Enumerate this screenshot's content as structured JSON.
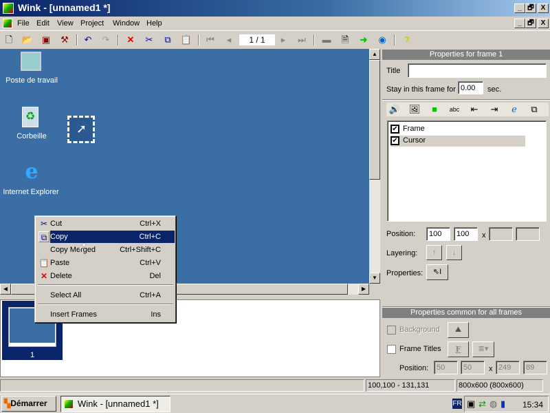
{
  "window": {
    "title": "Wink - [unnamed1 *]",
    "controls": [
      "_",
      "🗗",
      "X"
    ]
  },
  "menubar": {
    "items": [
      "File",
      "Edit",
      "View",
      "Project",
      "Window",
      "Help"
    ]
  },
  "toolbar": {
    "frame_counter": "1 / 1",
    "icons": [
      "new-icon",
      "open-icon",
      "save-icon",
      "build-icon",
      "undo-icon",
      "redo-icon",
      "delete-icon",
      "cut-icon",
      "copy-icon",
      "paste-icon",
      "first-frame-icon",
      "prev-frame-icon",
      "next-frame-icon",
      "last-frame-icon",
      "render-icon",
      "preview-icon",
      "export-icon",
      "browser-icon",
      "help-icon"
    ]
  },
  "desktop": {
    "icons": [
      {
        "label": "Poste de travail"
      },
      {
        "label": "Corbeille"
      },
      {
        "label": "Internet Explorer"
      }
    ]
  },
  "context_menu": {
    "items": [
      {
        "label": "Cut",
        "shortcut": "Ctrl+X",
        "icon": "cut-icon"
      },
      {
        "label": "Copy",
        "shortcut": "Ctrl+C",
        "icon": "copy-icon",
        "highlighted": true
      },
      {
        "label": "Copy Merged",
        "shortcut": "Ctrl+Shift+C"
      },
      {
        "label": "Paste",
        "shortcut": "Ctrl+V",
        "icon": "paste-icon"
      },
      {
        "label": "Delete",
        "shortcut": "Del",
        "icon": "delete-icon"
      },
      {
        "label": "Select All",
        "shortcut": "Ctrl+A"
      },
      {
        "label": "Insert Frames",
        "shortcut": "Ins"
      }
    ]
  },
  "thumbnails": [
    {
      "label": "1",
      "selected": true
    }
  ],
  "frame_props": {
    "header": "Properties for frame 1",
    "title_label": "Title",
    "title_value": "",
    "stay_label": "Stay in this frame for",
    "stay_value": "0.00",
    "stay_unit": "sec.",
    "objects": [
      {
        "label": "Frame",
        "checked": true
      },
      {
        "label": "Cursor",
        "checked": true,
        "selected": true
      }
    ],
    "position_label": "Position:",
    "pos_x": "100",
    "pos_y": "100",
    "pos_sep": "x",
    "pos_w": "",
    "pos_h": "",
    "layering_label": "Layering:",
    "properties_label": "Properties:"
  },
  "common_props": {
    "header": "Properties common for all frames",
    "background_label": "Background",
    "background_checked": false,
    "frame_titles_label": "Frame Titles",
    "frame_titles_checked": false,
    "font_button": "F",
    "position_label": "Position:",
    "x": "50",
    "y": "50",
    "sep": "x",
    "w": "249",
    "h": "89"
  },
  "status": {
    "coords": "100,100 - 131,131",
    "size": "800x600 (800x600)"
  },
  "taskbar": {
    "start": "Démarrer",
    "task": "Wink - [unnamed1 *]",
    "lang": "FR",
    "clock": "15:34"
  },
  "colors": {
    "desktop": "#3a6ea5",
    "highlight": "#0a246a",
    "titlebar": "#0a246a"
  }
}
